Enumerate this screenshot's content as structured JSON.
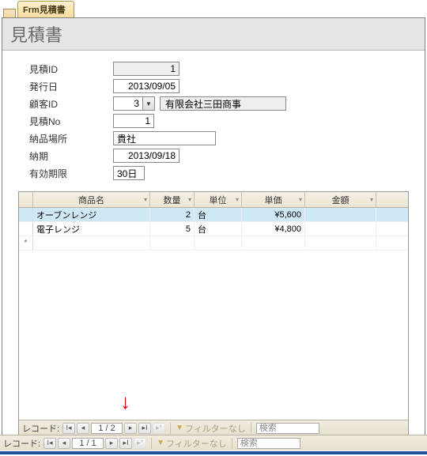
{
  "window": {
    "tab_label": "Frm見積書",
    "title": "見積書"
  },
  "fields": {
    "quote_id_label": "見積ID",
    "quote_id_value": "1",
    "issue_date_label": "発行日",
    "issue_date_value": "2013/09/05",
    "customer_id_label": "顧客ID",
    "customer_id_value": "3",
    "customer_name": "有限会社三田商事",
    "quote_no_label": "見積No",
    "quote_no_value": "1",
    "delivery_place_label": "納品場所",
    "delivery_place_value": "貴社",
    "delivery_date_label": "納期",
    "delivery_date_value": "2013/09/18",
    "valid_period_label": "有効期限",
    "valid_period_value": "30日"
  },
  "grid": {
    "headers": {
      "name": "商品名",
      "qty": "数量",
      "unit": "単位",
      "price": "単価",
      "amount": "金額"
    },
    "rows": [
      {
        "name": "オーブンレンジ",
        "qty": "2",
        "unit": "台",
        "price": "¥5,600",
        "amount": ""
      },
      {
        "name": "電子レンジ",
        "qty": "5",
        "unit": "台",
        "price": "¥4,800",
        "amount": ""
      }
    ],
    "new_row_marker": "*"
  },
  "nav_sub": {
    "label": "レコード:",
    "pos": "1 / 2",
    "filter": "フィルターなし",
    "search": "検索"
  },
  "nav_main": {
    "label": "レコード:",
    "pos": "1 / 1",
    "filter": "フィルターなし",
    "search": "検索"
  }
}
